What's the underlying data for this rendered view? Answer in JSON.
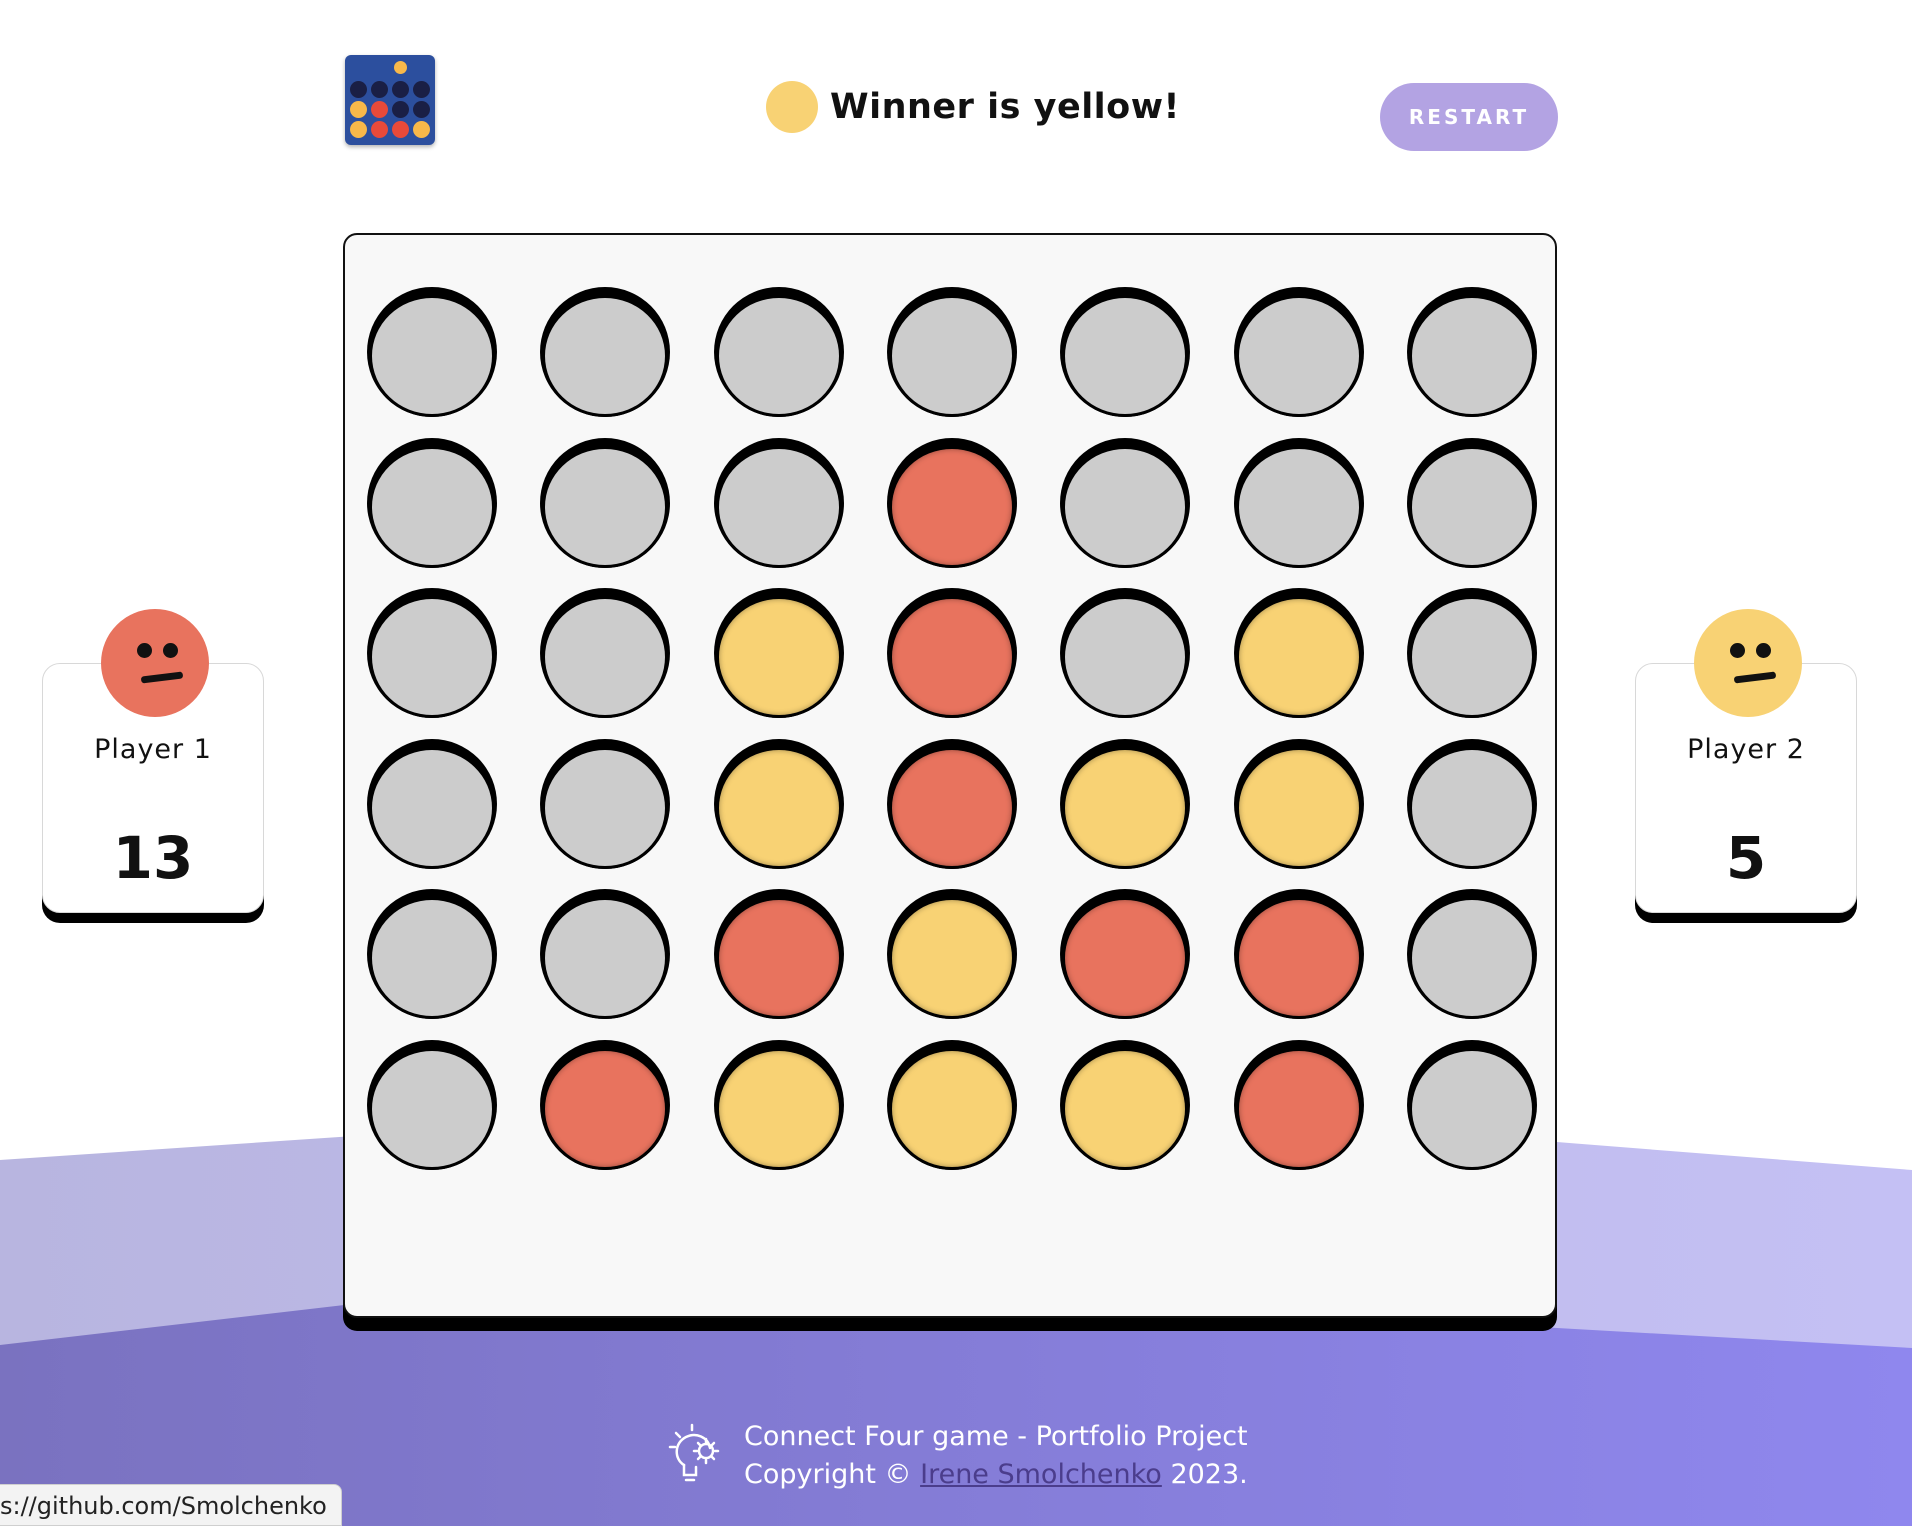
{
  "header": {
    "logo_icon": "connect-four-logo-icon",
    "status_text": "Winner is yellow!",
    "status_color": "#f8d274",
    "restart_label": "RESTART"
  },
  "colors": {
    "red": "#e8735e",
    "yellow": "#f8d274",
    "empty": "#cccccc",
    "accent": "#b3a3e3"
  },
  "board": {
    "rows": [
      [
        "empty",
        "empty",
        "empty",
        "empty",
        "empty",
        "empty",
        "empty"
      ],
      [
        "empty",
        "empty",
        "empty",
        "red",
        "empty",
        "empty",
        "empty"
      ],
      [
        "empty",
        "empty",
        "yellow",
        "red",
        "empty",
        "yellow",
        "empty"
      ],
      [
        "empty",
        "empty",
        "yellow",
        "red",
        "yellow",
        "yellow",
        "empty"
      ],
      [
        "empty",
        "empty",
        "red",
        "yellow",
        "red",
        "red",
        "empty"
      ],
      [
        "empty",
        "red",
        "yellow",
        "yellow",
        "yellow",
        "red",
        "empty"
      ]
    ]
  },
  "players": [
    {
      "name": "Player 1",
      "score": "13",
      "color": "#e8735e",
      "face_icon": "neutral-face-icon"
    },
    {
      "name": "Player 2",
      "score": "5",
      "color": "#f8d274",
      "face_icon": "neutral-face-icon"
    }
  ],
  "footer": {
    "icon": "lightbulb-gear-icon",
    "line1": "Connect Four game - Portfolio Project",
    "copyright_prefix": "Copyright ©",
    "author": "Irene Smolchenko",
    "year_suffix": "2023."
  },
  "status_bar": {
    "url": "s://github.com/Smolchenko"
  }
}
